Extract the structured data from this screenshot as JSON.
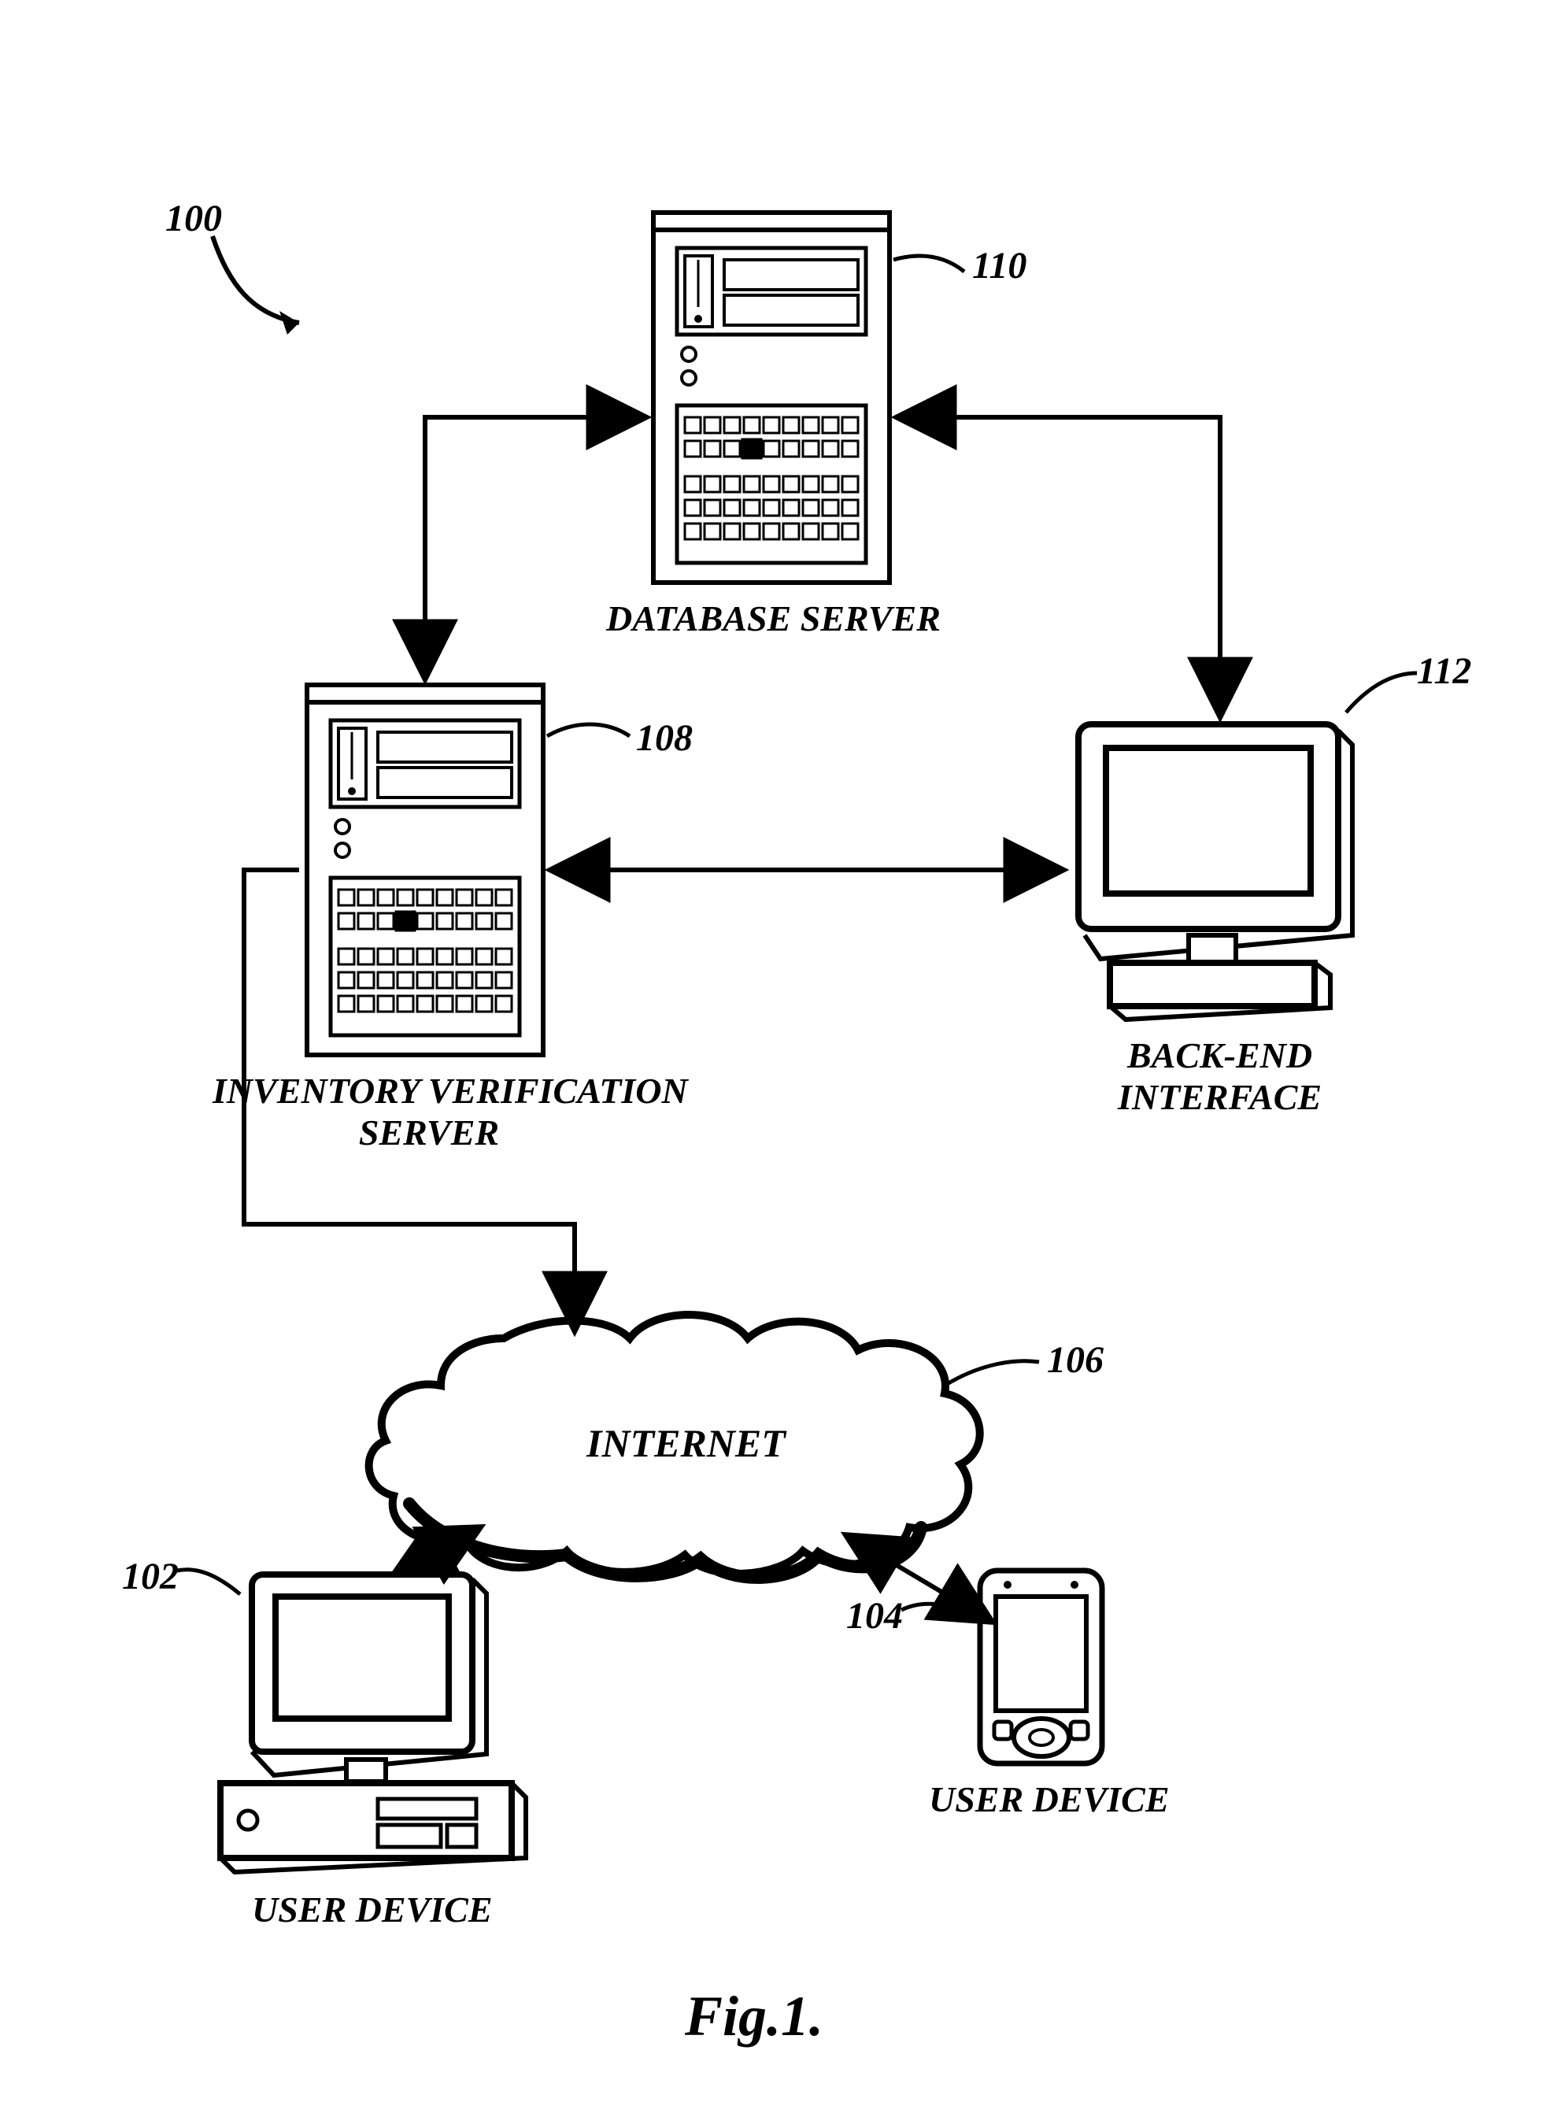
{
  "figure": {
    "caption": "Fig.1."
  },
  "refs": {
    "system": "100",
    "user_device_pc": "102",
    "user_device_pda": "104",
    "internet": "106",
    "inventory_server": "108",
    "database_server": "110",
    "backend_interface": "112"
  },
  "labels": {
    "database_server": "DATABASE SERVER",
    "inventory_server": "INVENTORY VERIFICATION\nSERVER",
    "backend_interface": "BACK-END\nINTERFACE",
    "internet": "INTERNET",
    "user_device_pc": "USER DEVICE",
    "user_device_pda": "USER DEVICE"
  }
}
